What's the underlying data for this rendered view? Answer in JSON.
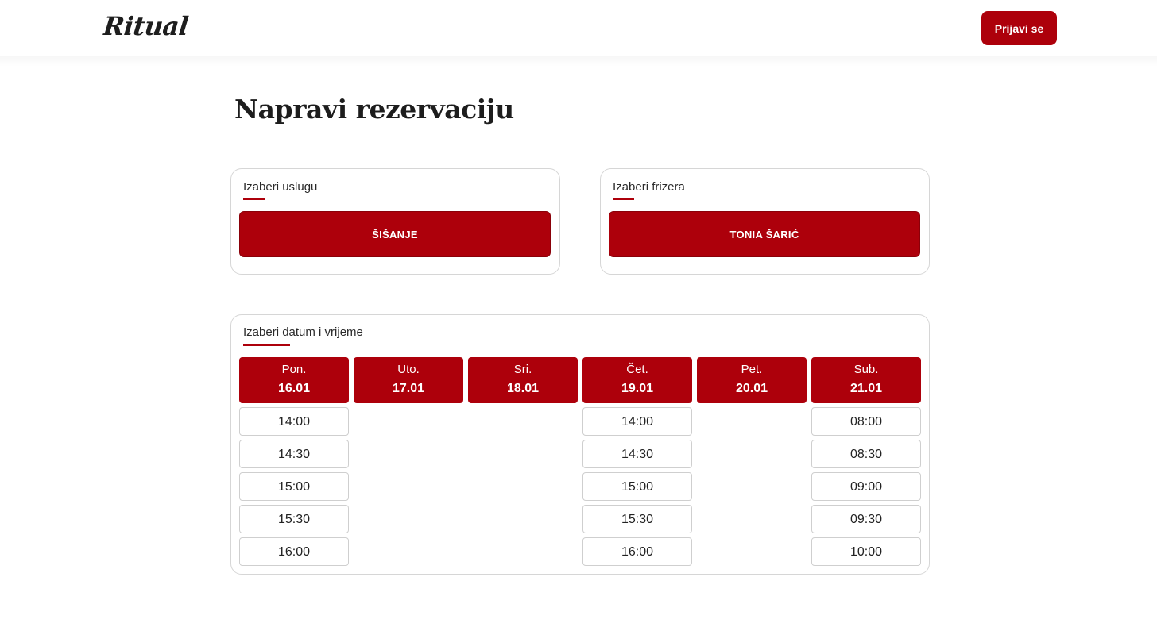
{
  "header": {
    "logo": "Ritual",
    "login_label": "Prijavi se"
  },
  "page": {
    "title": "Napravi rezervaciju"
  },
  "service": {
    "label": "Izaberi uslugu",
    "selected": "ŠIŠANJE"
  },
  "barber": {
    "label": "Izaberi frizera",
    "selected": "TONIA ŠARIĆ"
  },
  "schedule": {
    "label": "Izaberi datum i vrijeme",
    "days": [
      {
        "name": "Pon.",
        "date": "16.01",
        "slots": [
          "14:00",
          "14:30",
          "15:00",
          "15:30",
          "16:00"
        ]
      },
      {
        "name": "Uto.",
        "date": "17.01",
        "slots": []
      },
      {
        "name": "Sri.",
        "date": "18.01",
        "slots": []
      },
      {
        "name": "Čet.",
        "date": "19.01",
        "slots": [
          "14:00",
          "14:30",
          "15:00",
          "15:30",
          "16:00"
        ]
      },
      {
        "name": "Pet.",
        "date": "20.01",
        "slots": []
      },
      {
        "name": "Sub.",
        "date": "21.01",
        "slots": [
          "08:00",
          "08:30",
          "09:00",
          "09:30",
          "10:00"
        ]
      }
    ]
  },
  "colors": {
    "accent": "#ad000b",
    "border": "#d6d6d6",
    "text": "#222222"
  }
}
